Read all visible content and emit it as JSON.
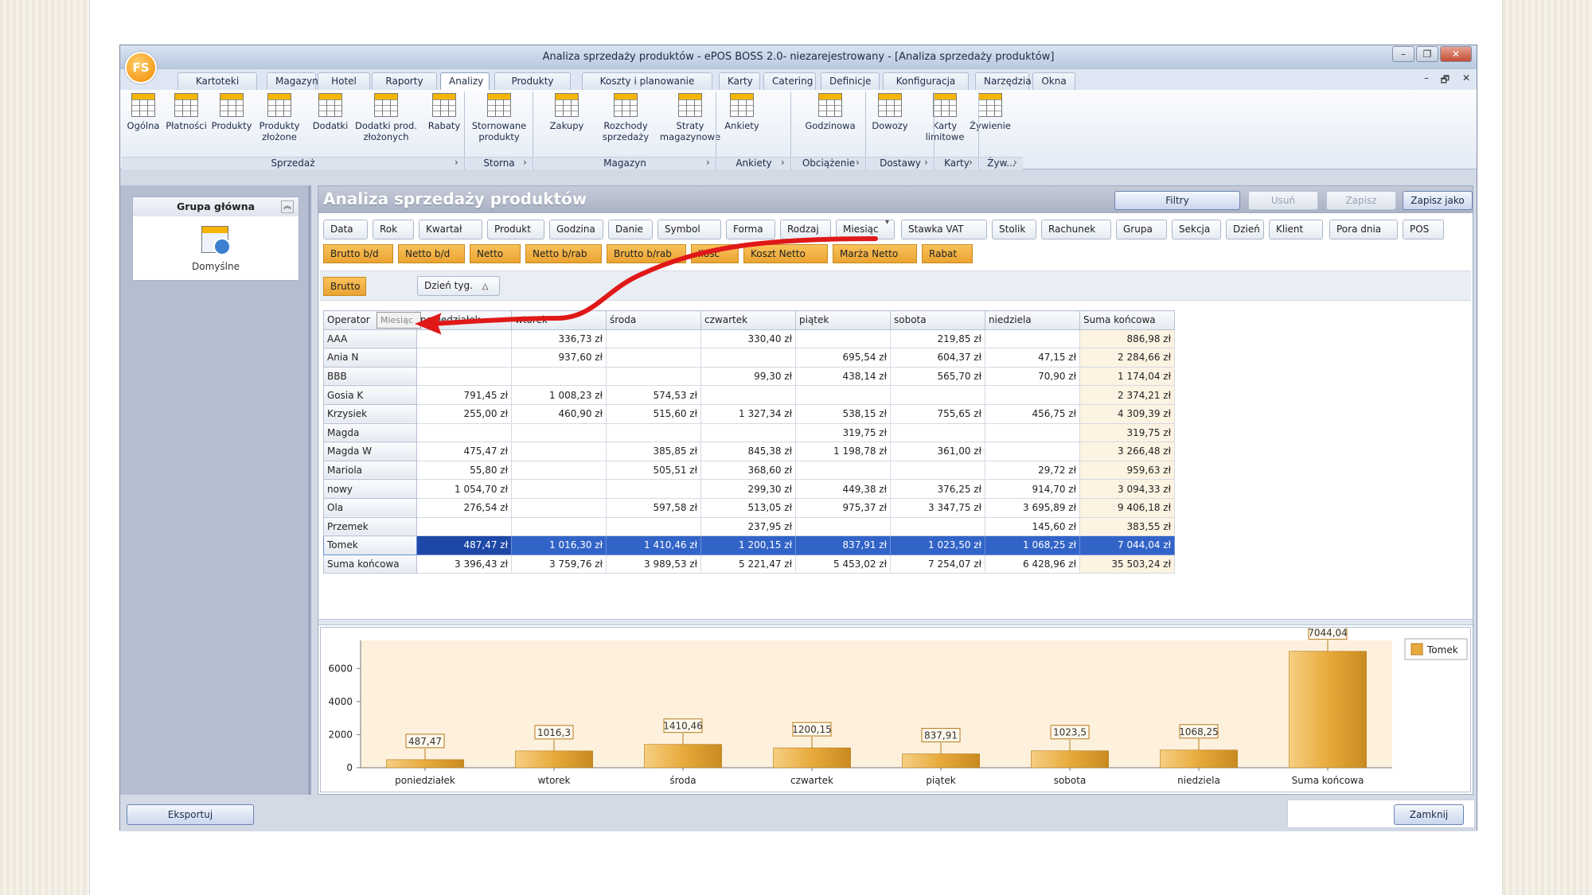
{
  "window": {
    "title": "Analiza sprzedaży produktów - ePOS BOSS 2.0- niezarejestrowany - [Analiza sprzedaży produktów]",
    "logo_text": "FS"
  },
  "menu_tabs": [
    "Kartoteki",
    "Magazyn",
    "Hotel",
    "Raporty",
    "Analizy",
    "Produkty",
    "Koszty i planowanie",
    "Karty",
    "Catering",
    "Definicje",
    "Konfiguracja",
    "Narzędzia",
    "Okna"
  ],
  "active_tab": "Analizy",
  "ribbon": {
    "buttons": [
      {
        "label": "Ogólna"
      },
      {
        "label": "Płatności"
      },
      {
        "label": "Produkty"
      },
      {
        "label": "Produkty złożone"
      },
      {
        "label": "Dodatki"
      },
      {
        "label": "Dodatki prod. złożonych"
      },
      {
        "label": "Rabaty"
      },
      {
        "label": "Stornowane produkty"
      },
      {
        "label": "Zakupy"
      },
      {
        "label": "Rozchody sprzedaży"
      },
      {
        "label": "Straty magazynowe"
      },
      {
        "label": "Ankiety"
      },
      {
        "label": "Godzinowa"
      },
      {
        "label": "Dowozy"
      },
      {
        "label": "Karty limitowe"
      },
      {
        "label": "Żywienie"
      }
    ],
    "groups": [
      "Sprzedaż",
      "Storna",
      "Magazyn",
      "Ankiety",
      "Obciążenie",
      "Dostawy",
      "Karty",
      "Żyw..."
    ]
  },
  "sidebar": {
    "group_title": "Grupa główna",
    "item_label": "Domyślne"
  },
  "main": {
    "title": "Analiza sprzedaży produktów",
    "buttons": {
      "filtry": "Filtry",
      "usun": "Usuń",
      "zapisz": "Zapisz",
      "zapisz_jako": "Zapisz jako"
    }
  },
  "field_chips": [
    "Data",
    "Rok",
    "Kwartał",
    "Produkt",
    "Godzina",
    "Danie",
    "Symbol",
    "Forma",
    "Rodzaj",
    "Miesiąc",
    "Stawka VAT",
    "Stolik",
    "Rachunek",
    "Grupa",
    "Sekcja",
    "Dzień",
    "Klient",
    "Pora dnia",
    "POS"
  ],
  "data_chips": [
    "Brutto b/d",
    "Netto b/d",
    "Netto",
    "Netto b/rab",
    "Brutto b/rab",
    "Ilość",
    "Koszt Netto",
    "Marża Netto",
    "Rabat"
  ],
  "data_field": "Brutto",
  "column_field": "Dzień tyg.",
  "row_field": "Operator",
  "drag_label": "Miesiąc",
  "table": {
    "columns": [
      "poniedziałek",
      "wtorek",
      "środa",
      "czwartek",
      "piątek",
      "sobota",
      "niedziela",
      "Suma końcowa"
    ],
    "rows": [
      {
        "name": "AAA",
        "cells": [
          "",
          "336,73 zł",
          "",
          "330,40 zł",
          "",
          "219,85 zł",
          "",
          "886,98 zł"
        ]
      },
      {
        "name": "Ania N",
        "cells": [
          "",
          "937,60 zł",
          "",
          "",
          "695,54 zł",
          "604,37 zł",
          "47,15 zł",
          "2 284,66 zł"
        ]
      },
      {
        "name": "BBB",
        "cells": [
          "",
          "",
          "",
          "99,30 zł",
          "438,14 zł",
          "565,70 zł",
          "70,90 zł",
          "1 174,04 zł"
        ]
      },
      {
        "name": "Gosia K",
        "cells": [
          "791,45 zł",
          "1 008,23 zł",
          "574,53 zł",
          "",
          "",
          "",
          "",
          "2 374,21 zł"
        ]
      },
      {
        "name": "Krzysiek",
        "cells": [
          "255,00 zł",
          "460,90 zł",
          "515,60 zł",
          "1 327,34 zł",
          "538,15 zł",
          "755,65 zł",
          "456,75 zł",
          "4 309,39 zł"
        ]
      },
      {
        "name": "Magda",
        "cells": [
          "",
          "",
          "",
          "",
          "319,75 zł",
          "",
          "",
          "319,75 zł"
        ]
      },
      {
        "name": "Magda W",
        "cells": [
          "475,47 zł",
          "",
          "385,85 zł",
          "845,38 zł",
          "1 198,78 zł",
          "361,00 zł",
          "",
          "3 266,48 zł"
        ]
      },
      {
        "name": "Mariola",
        "cells": [
          "55,80 zł",
          "",
          "505,51 zł",
          "368,60 zł",
          "",
          "",
          "29,72 zł",
          "959,63 zł"
        ]
      },
      {
        "name": "nowy",
        "cells": [
          "1 054,70 zł",
          "",
          "",
          "299,30 zł",
          "449,38 zł",
          "376,25 zł",
          "914,70 zł",
          "3 094,33 zł"
        ]
      },
      {
        "name": "Ola",
        "cells": [
          "276,54 zł",
          "",
          "597,58 zł",
          "513,05 zł",
          "975,37 zł",
          "3 347,75 zł",
          "3 695,89 zł",
          "9 406,18 zł"
        ]
      },
      {
        "name": "Przemek",
        "cells": [
          "",
          "",
          "",
          "237,95 zł",
          "",
          "",
          "145,60 zł",
          "383,55 zł"
        ]
      },
      {
        "name": "Tomek",
        "cells": [
          "487,47 zł",
          "1 016,30 zł",
          "1 410,46 zł",
          "1 200,15 zł",
          "837,91 zł",
          "1 023,50 zł",
          "1 068,25 zł",
          "7 044,04 zł"
        ]
      },
      {
        "name": "Suma końcowa",
        "cells": [
          "3 396,43 zł",
          "3 759,76 zł",
          "3 989,53 zł",
          "5 221,47 zł",
          "5 453,02 zł",
          "7 254,07 zł",
          "6 428,96 zł",
          "35 503,24 zł"
        ]
      }
    ],
    "selected_row": "Tomek"
  },
  "chart_data": {
    "type": "bar",
    "categories": [
      "poniedziałek",
      "wtorek",
      "środa",
      "czwartek",
      "piątek",
      "sobota",
      "niedziela",
      "Suma końcowa"
    ],
    "series": [
      {
        "name": "Tomek",
        "values": [
          487.47,
          1016.3,
          1410.46,
          1200.15,
          837.91,
          1023.5,
          1068.25,
          7044.04
        ]
      }
    ],
    "value_labels": [
      "487,47",
      "1016,3",
      "1410,46",
      "1200,15",
      "837,91",
      "1023,5",
      "1068,25",
      "7044,04"
    ],
    "yticks": [
      "0",
      "2000",
      "4000",
      "6000"
    ],
    "ylim": [
      0,
      7700
    ],
    "legend": "top-right",
    "colors": {
      "bar": "#e8aa3c",
      "bar_light": "#f6cf82",
      "plot_bg": "#fdf1de"
    }
  },
  "bottom": {
    "export": "Eksportuj",
    "close": "Zamknij"
  },
  "colors": {
    "accent_orange": "#eaa332",
    "selection_blue": "#3264c8",
    "arrow_red": "#e01818"
  }
}
